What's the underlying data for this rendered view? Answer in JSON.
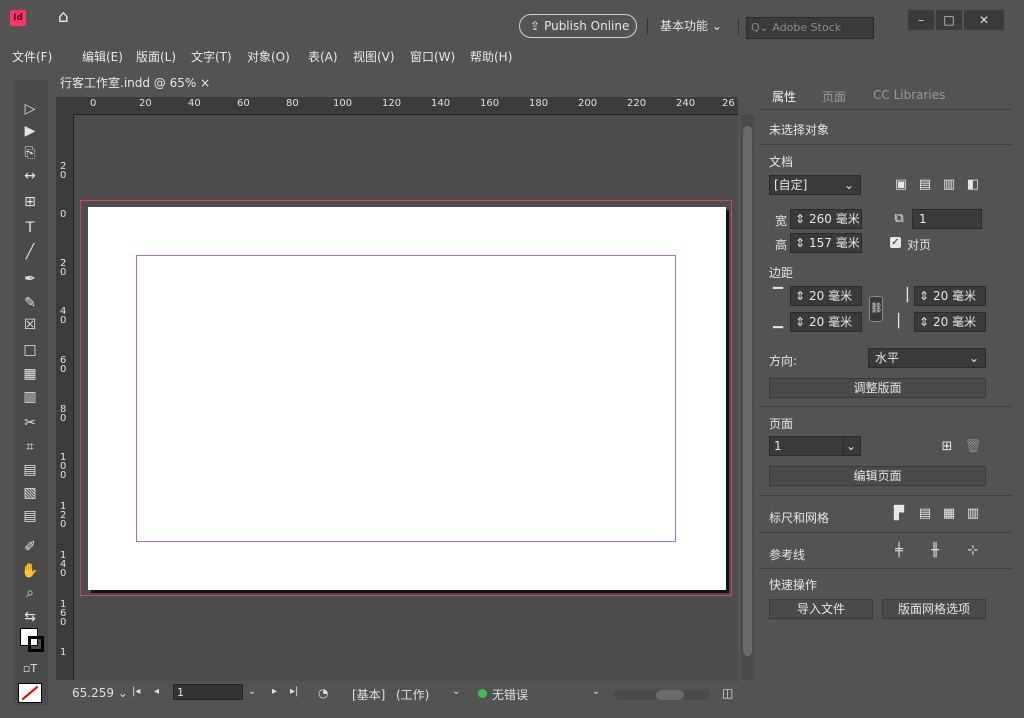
{
  "titlebar": {
    "app_icon_text": "Id",
    "publish_label": "Publish Online",
    "workspace_label": "基本功能 ⌄",
    "stock_placeholder": "Q⌄ Adobe Stock",
    "min": "–",
    "max": "□",
    "close": "✕"
  },
  "menu": [
    "文件(F)",
    "编辑(E)",
    "版面(L)",
    "文字(T)",
    "对象(O)",
    "表(A)",
    "视图(V)",
    "窗口(W)",
    "帮助(H)"
  ],
  "document": {
    "tab_label": "行客工作室.indd @ 65% ×"
  },
  "ruler": {
    "h_ticks": [
      "0",
      "20",
      "40",
      "60",
      "80",
      "100",
      "120",
      "140",
      "160",
      "180",
      "200",
      "220",
      "240",
      "26"
    ],
    "v_ticks": [
      "2 0",
      "0",
      "2 0",
      "4 0",
      "6 0",
      "8 0",
      "1 0 0",
      "1 2 0",
      "1 4 0",
      "1 6 0",
      "1"
    ]
  },
  "status": {
    "zoom": "65.259 ⌄",
    "page": "1",
    "master": "[基本]",
    "mode": "(工作)",
    "errors": "无错误"
  },
  "panel": {
    "tabs": [
      "属性",
      "页面",
      "CC Libraries"
    ],
    "no_selection": "未选择对象",
    "doc_section": "文档",
    "preset": "[自定]",
    "width_label": "宽",
    "width": "260 毫米",
    "height_label": "高",
    "height": "157 毫米",
    "pages_count": "1",
    "facing_pages": "对页",
    "margins_section": "边距",
    "margin_top": "20 毫米",
    "margin_bottom": "20 毫米",
    "margin_left": "20 毫米",
    "margin_right": "20 毫米",
    "orientation_label": "方向:",
    "orientation": "水平",
    "adjust_layout": "调整版面",
    "pages_section": "页面",
    "page_select": "1",
    "edit_page": "编辑页面",
    "rulers_grids": "标尺和网格",
    "guides": "参考线",
    "quick_actions": "快速操作",
    "import_file": "导入文件",
    "layout_grid_options": "版面网格选项"
  }
}
